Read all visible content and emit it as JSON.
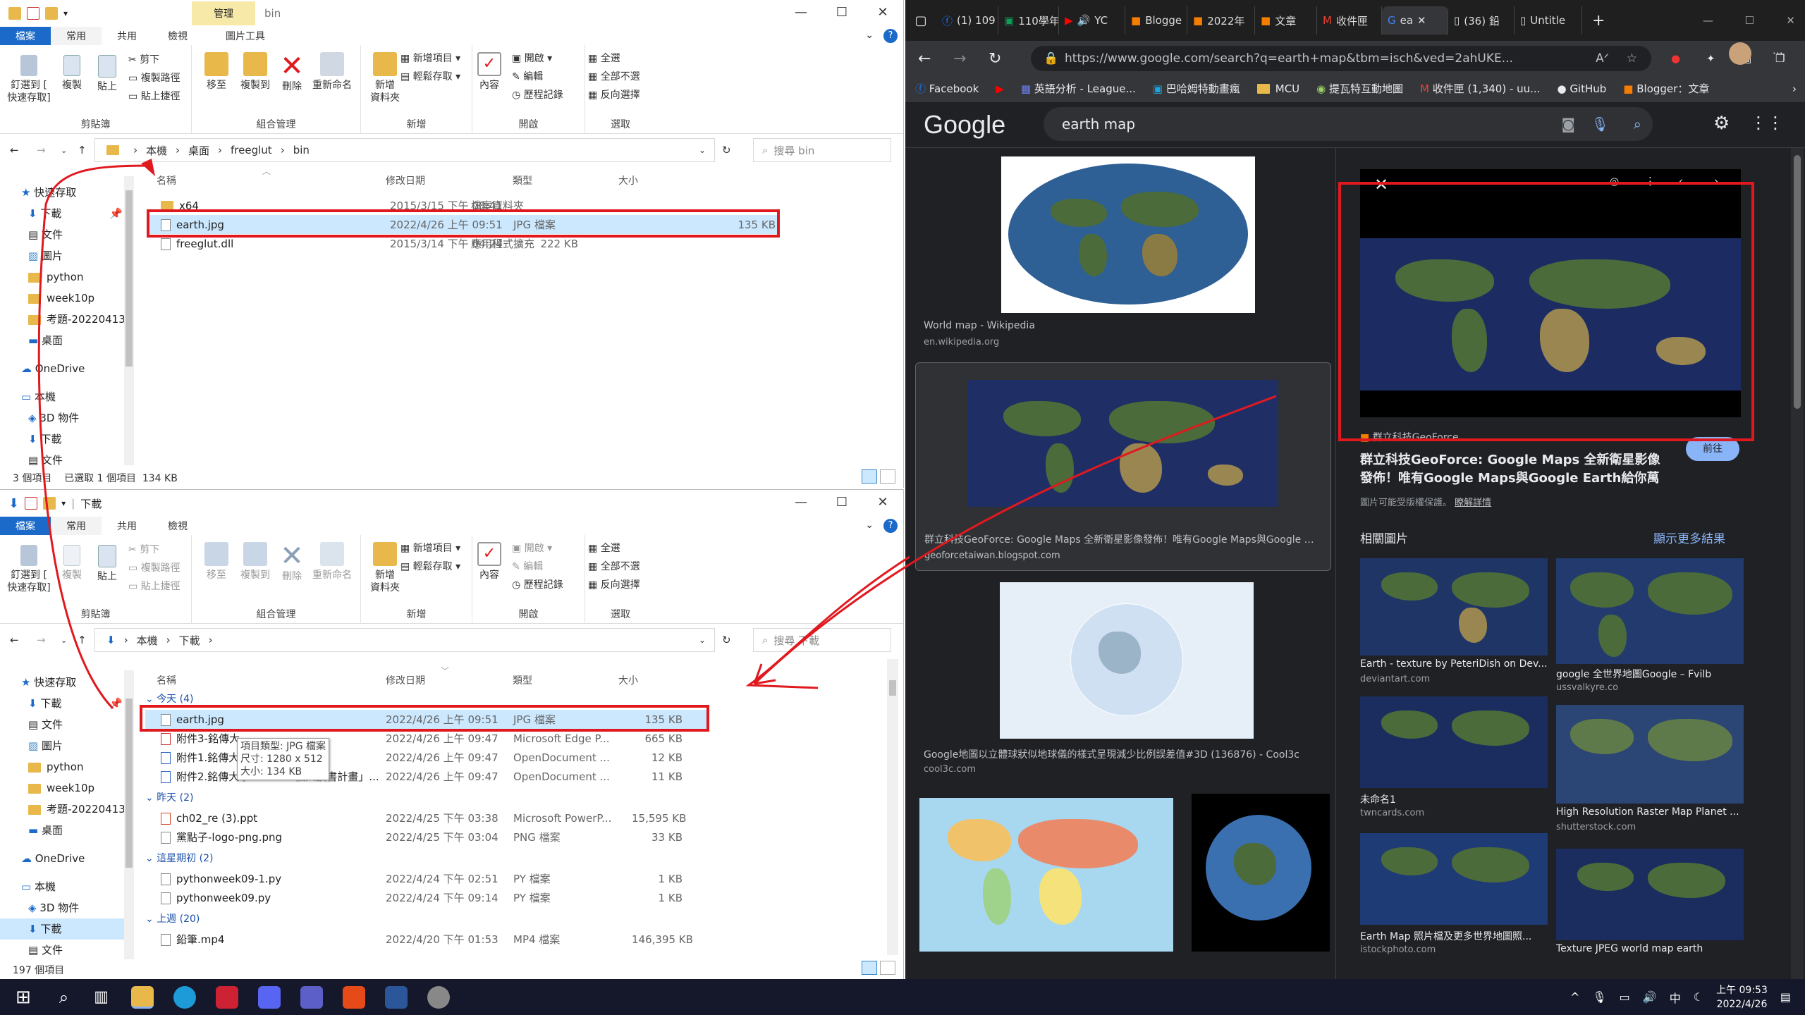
{
  "explorer_top": {
    "tabs": [
      "檔案",
      "常用",
      "共用",
      "檢視",
      "圖片工具"
    ],
    "manage_tab": "管理",
    "title": "bin",
    "ribbon": {
      "pin": "釘選到 [\n快速存取]",
      "copy": "複製",
      "paste": "貼上",
      "cut": "剪下",
      "copy_path": "複製路徑",
      "paste_shortcut": "貼上捷徑",
      "clipboard": "剪貼簿",
      "move_to": "移至",
      "copy_to": "複製到",
      "delete": "刪除",
      "rename": "重新命名",
      "organize": "組合管理",
      "new_folder": "新增\n資料夾",
      "new_item": "新增項目",
      "easy_access": "輕鬆存取",
      "new": "新增",
      "properties": "內容",
      "open": "開啟",
      "edit": "編輯",
      "history": "歷程記錄",
      "open_group": "開啟",
      "select_all": "全選",
      "select_none": "全部不選",
      "invert": "反向選擇",
      "select": "選取"
    },
    "path": [
      "本機",
      "桌面",
      "freeglut",
      "bin"
    ],
    "search_placeholder": "搜尋 bin",
    "nav": [
      "快速存取",
      "下載",
      "文件",
      "圖片",
      "python",
      "week10p",
      "考題-20220413",
      "桌面",
      "OneDrive",
      "本機",
      "3D 物件",
      "下載",
      "文件"
    ],
    "columns": [
      "名稱",
      "修改日期",
      "類型",
      "大小"
    ],
    "files": [
      {
        "name": "x64",
        "date": "2015/3/15 下午 08:41",
        "type": "檔案資料夾",
        "size": ""
      },
      {
        "name": "earth.jpg",
        "date": "2022/4/26 上午 09:51",
        "type": "JPG 檔案",
        "size": "135 KB"
      },
      {
        "name": "freeglut.dll",
        "date": "2015/3/14 下午 04:24",
        "type": "應用程式擴充",
        "size": "222 KB"
      }
    ],
    "status": "3 個項目    已選取 1 個項目  134 KB"
  },
  "explorer_bottom": {
    "title": "下載",
    "path": [
      "本機",
      "下載"
    ],
    "search_placeholder": "搜尋 下載",
    "nav": [
      "快速存取",
      "下載",
      "文件",
      "圖片",
      "python",
      "week10p",
      "考題-20220413",
      "桌面",
      "OneDrive",
      "本機",
      "3D 物件",
      "下載",
      "文件"
    ],
    "groups": [
      {
        "label": "今天 (4)",
        "files": [
          {
            "name": "earth.jpg",
            "date": "2022/4/26 上午 09:51",
            "type": "JPG 檔案",
            "size": "135 KB"
          },
          {
            "name": "附件3-銘傳大",
            "date": "2022/4/26 上午 09:47",
            "type": "Microsoft Edge P...",
            "size": "665 KB"
          },
          {
            "name": "附件1.銘傳大",
            "date": "2022/4/26 上午 09:47",
            "type": "OpenDocument ...",
            "size": "12 KB"
          },
          {
            "name": "附件2.銘傳大學110-2-「個人讀書計畫」...",
            "date": "2022/4/26 上午 09:47",
            "type": "OpenDocument ...",
            "size": "11 KB"
          }
        ]
      },
      {
        "label": "昨天 (2)",
        "files": [
          {
            "name": "ch02_re (3).ppt",
            "date": "2022/4/25 下午 03:38",
            "type": "Microsoft PowerP...",
            "size": "15,595 KB"
          },
          {
            "name": "黨點子-logo-png.png",
            "date": "2022/4/25 下午 03:04",
            "type": "PNG 檔案",
            "size": "33 KB"
          }
        ]
      },
      {
        "label": "這星期初 (2)",
        "files": [
          {
            "name": "pythonweek09-1.py",
            "date": "2022/4/24 下午 02:51",
            "type": "PY 檔案",
            "size": "1 KB"
          },
          {
            "name": "pythonweek09.py",
            "date": "2022/4/24 下午 09:14",
            "type": "PY 檔案",
            "size": "1 KB"
          }
        ]
      },
      {
        "label": "上週 (20)",
        "files": [
          {
            "name": "鉛筆.mp4",
            "date": "2022/4/20 下午 01:53",
            "type": "MP4 檔案",
            "size": "146,395 KB"
          }
        ]
      }
    ],
    "tooltip": [
      "項目類型: JPG 檔案",
      "尺寸: 1280 x 512",
      "大小: 134 KB"
    ],
    "status": "197 個項目"
  },
  "browser": {
    "tabs": [
      "(1) 109",
      "110學年",
      "YC",
      "Blogge",
      "2022年",
      "文章",
      "收件匣",
      "ea",
      "(36) 鉛",
      "Untitle"
    ],
    "url": "https://www.google.com/search?q=earth+map&tbm=isch&ved=2ahUKE...",
    "bookmarks": [
      "Facebook",
      "英語分析 - League...",
      "巴哈姆特動畫瘋",
      "MCU",
      "提瓦特互動地圖",
      "收件匣 (1,340) - uu...",
      "GitHub",
      "Blogger：文章"
    ],
    "search_query": "earth map",
    "results": [
      {
        "title": "World map - Wikipedia",
        "source": "en.wikipedia.org"
      },
      {
        "title": "群立科技GeoForce: Google Maps 全新衛星影像發佈！唯有Google Maps與Google E...",
        "source": "geoforcetaiwan.blogspot.com"
      },
      {
        "title": "Google地圖以立體球狀似地球儀的樣式呈現減少比例誤差值#3D (136876) - Cool3c",
        "source": "cool3c.com"
      }
    ],
    "preview": {
      "source_name": "群立科技GeoForce",
      "title": "群立科技GeoForce: Google Maps 全新衛星影像發佈！唯有Google Maps與Google Earth給你萬里晴...",
      "copyright": "圖片可能受版權保護。",
      "details": "瞭解詳情",
      "visit": "前往"
    },
    "related_heading": "相關圖片",
    "see_more": "顯示更多結果",
    "related": [
      {
        "title": "Earth - texture by PeteriDish on Dev...",
        "source": "deviantart.com"
      },
      {
        "title": "google 全世界地圖Google – Fvilb",
        "source": "ussvalkyre.co"
      },
      {
        "title": "未命名1",
        "source": "twncards.com"
      },
      {
        "title": "High Resolution Raster Map Planet ...",
        "source": "shutterstock.com"
      },
      {
        "title": "Earth Map 照片檔及更多世界地圖照...",
        "source": "istockphoto.com"
      },
      {
        "title": "Texture JPEG world map earth",
        "source": ""
      }
    ]
  },
  "taskbar": {
    "time": "上午 09:53",
    "date": "2022/4/26",
    "ime": "中"
  }
}
